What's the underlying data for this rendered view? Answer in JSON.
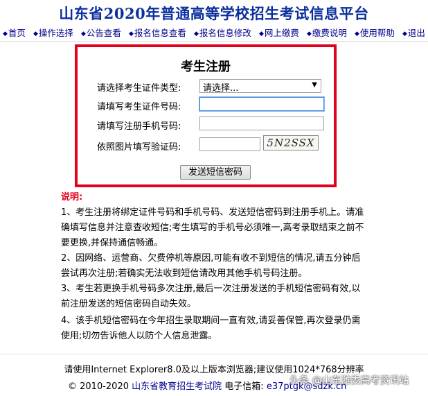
{
  "header": {
    "title": "山东省2020年普通高等学校招生考试信息平台"
  },
  "nav": {
    "bullet": "◆",
    "items": [
      "首页",
      "操作选择",
      "公告查看",
      "报名信息查看",
      "报名信息修改",
      "网上缴费",
      "缴费说明",
      "使用帮助",
      "退出"
    ]
  },
  "form": {
    "title": "考生注册",
    "id_type_label": "请选择考生证件类型:",
    "id_type_selected": "请选择...",
    "id_number_label": "请填写考生证件号码:",
    "id_number_value": "",
    "phone_label": "请填写注册手机号码:",
    "phone_value": "",
    "captcha_label": "依照图片填写验证码:",
    "captcha_value": "",
    "captcha_image_text": "5N2SSX",
    "send_button": "发送短信密码"
  },
  "notes": {
    "heading": "说明:",
    "items": [
      "1、考生注册将绑定证件号码和手机号码、发送短信密码到注册手机上。请准确填写信息并注意查收短信;考生填写的手机号必须唯一,高考录取结束之前不要更换,并保持通信畅通。",
      "2、因网络、运营商、欠费停机等原因,可能有收不到短信的情况,请五分钟后尝试再次注册;若确实无法收到短信请改用其他手机号码注册。",
      "3、考生若更换手机号码多次注册,最后一次注册发送的手机短信密码有效,以前注册发送的短信密码自动失效。",
      "4、该手机短信密码在今年招生录取期间一直有效,请妥善保管,再次登录仍需使用;切勿告诉他人以防个人信息泄露。"
    ]
  },
  "footer": {
    "browser_note": "请使用Internet Explorer8.0及以上版本浏览器;建议使用1024*768分辨率",
    "copyright": "© 2010-2020",
    "org_link": "山东省教育招生考试院",
    "email_label": "电子信箱:",
    "email": "e37ptgk@sdzk.cn"
  },
  "watermark": "头条 @山东潍委高考资讯站"
}
